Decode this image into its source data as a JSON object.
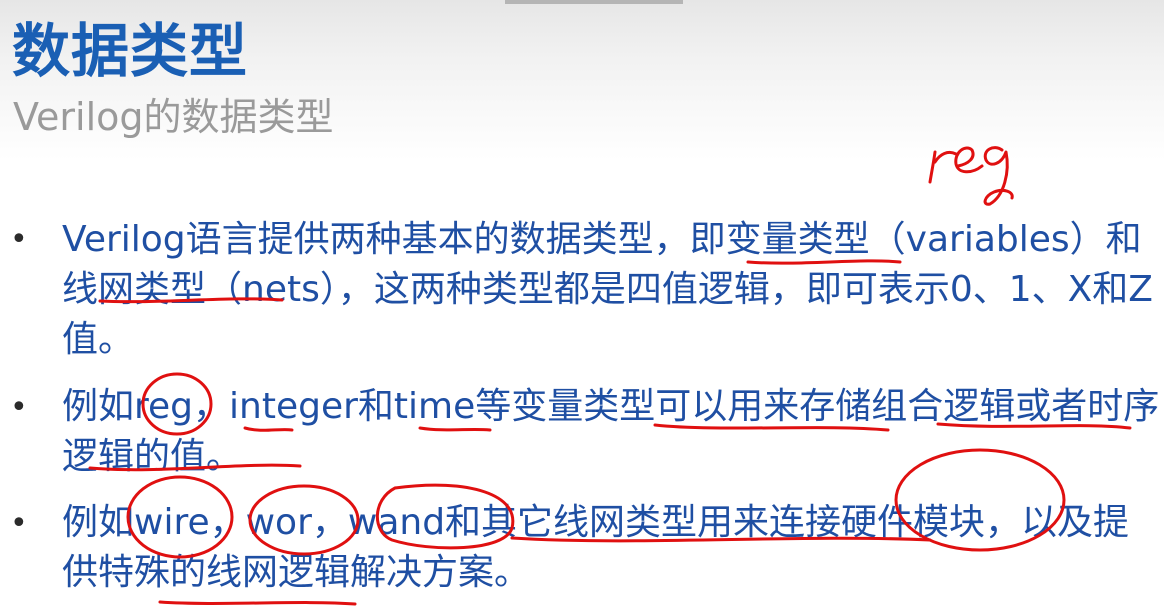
{
  "slide": {
    "title": "数据类型",
    "subtitle": "Verilog的数据类型",
    "annotation": "reg",
    "bullets": [
      {
        "marker": "•",
        "text": "Verilog语言提供两种基本的数据类型，即变量类型（variables）和线网类型（nets），这两种类型都是四值逻辑，即可表示0、1、X和Z值。"
      },
      {
        "marker": "•",
        "text": "例如reg，integer和time等变量类型可以用来存储组合逻辑或者时序逻辑的值。"
      },
      {
        "marker": "•",
        "text": "例如wire，wor，wand和其它线网类型用来连接硬件模块，以及提供特殊的线网逻辑解决方案。"
      }
    ]
  },
  "colors": {
    "title": "#1a5fb4",
    "body": "#1f4fa3",
    "subtitle": "#9a9a9a",
    "ink": "#e01010"
  }
}
